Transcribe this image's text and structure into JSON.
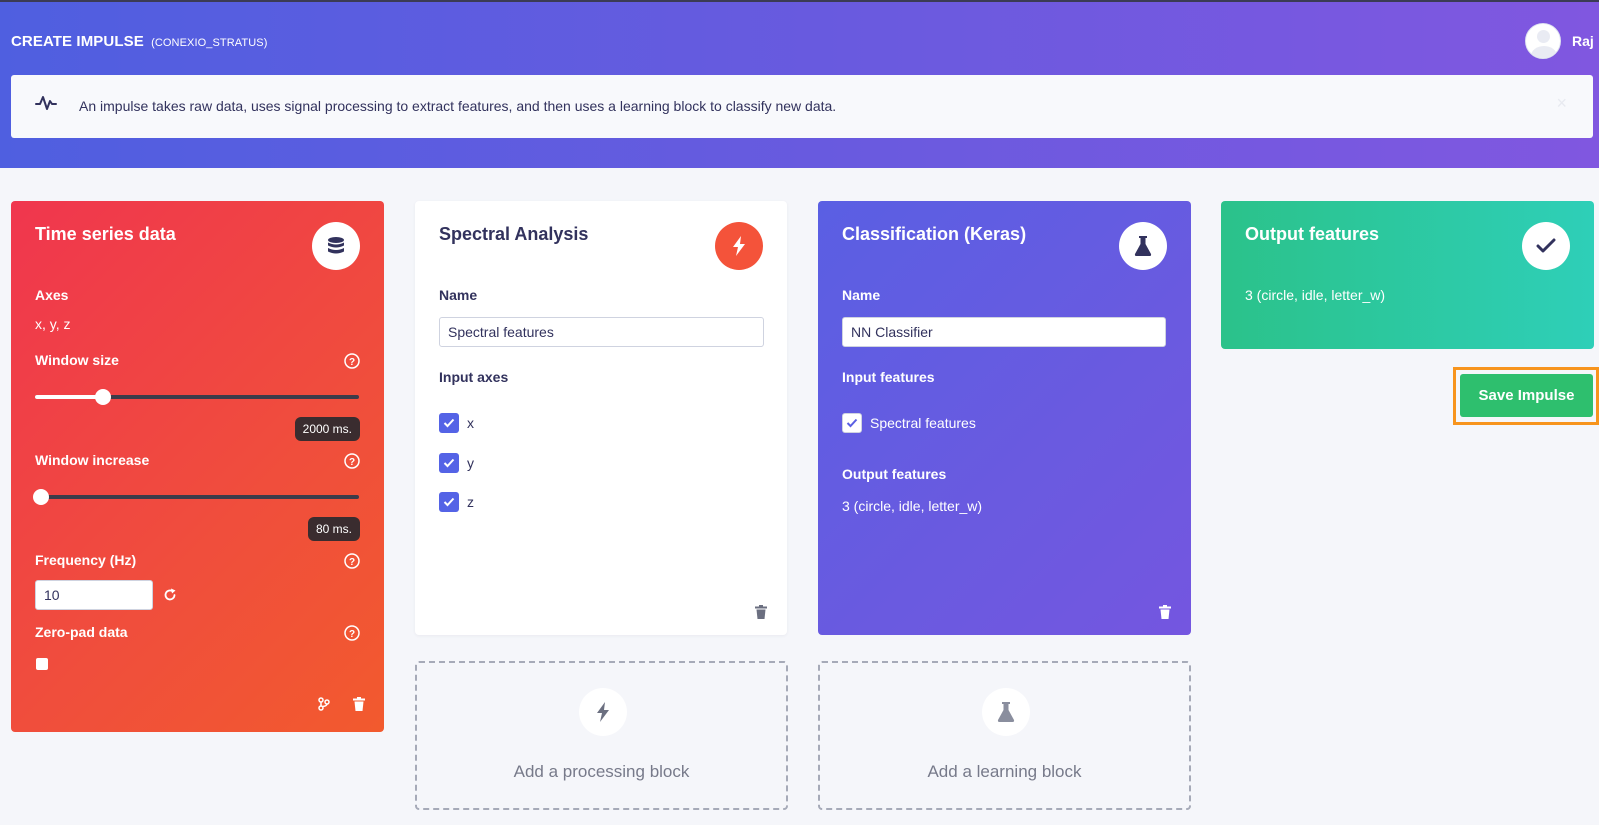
{
  "header": {
    "title": "CREATE IMPULSE",
    "project": "(CONEXIO_STRATUS)",
    "user_name": "Raj"
  },
  "info_bar": {
    "icon": "pulse-icon",
    "text": "An impulse takes raw data, uses signal processing to extract features, and then uses a learning block to classify new data.",
    "close_label": "×"
  },
  "input_block": {
    "title": "Time series data",
    "icon": "database-icon",
    "axes_label": "Axes",
    "axes_value": "x, y, z",
    "window_size_label": "Window size",
    "window_size_value": "2000 ms.",
    "window_size_slider_fraction": 0.21,
    "window_increase_label": "Window increase",
    "window_increase_value": "80 ms.",
    "window_increase_slider_fraction": 0.02,
    "frequency_label": "Frequency (Hz)",
    "frequency_value": "10",
    "zero_pad_label": "Zero-pad data",
    "zero_pad_checked": false
  },
  "processing_block": {
    "title": "Spectral Analysis",
    "icon": "bolt-icon",
    "name_label": "Name",
    "name_value": "Spectral features",
    "input_axes_label": "Input axes",
    "axes": [
      {
        "label": "x",
        "checked": true
      },
      {
        "label": "y",
        "checked": true
      },
      {
        "label": "z",
        "checked": true
      }
    ]
  },
  "learning_block": {
    "title": "Classification (Keras)",
    "icon": "flask-icon",
    "name_label": "Name",
    "name_value": "NN Classifier",
    "input_features_label": "Input features",
    "input_feature": "Spectral features",
    "input_feature_checked": true,
    "output_features_label": "Output features",
    "output_features_value": "3 (circle, idle, letter_w)"
  },
  "output_block": {
    "title": "Output features",
    "icon": "check-icon",
    "value": "3 (circle, idle, letter_w)"
  },
  "add_processing_block": "Add a processing block",
  "add_learning_block": "Add a learning block",
  "save_button": "Save Impulse",
  "colors": {
    "header_gradient_start": "#4f5fe0",
    "header_gradient_end": "#8057e0",
    "input_block": "#f0364e",
    "processing_badge": "#f4533a",
    "learning_block": "#5a5fe3",
    "output_block": "#2bc28a",
    "save_button": "#2ebf6e",
    "save_highlight": "#f7941d"
  }
}
